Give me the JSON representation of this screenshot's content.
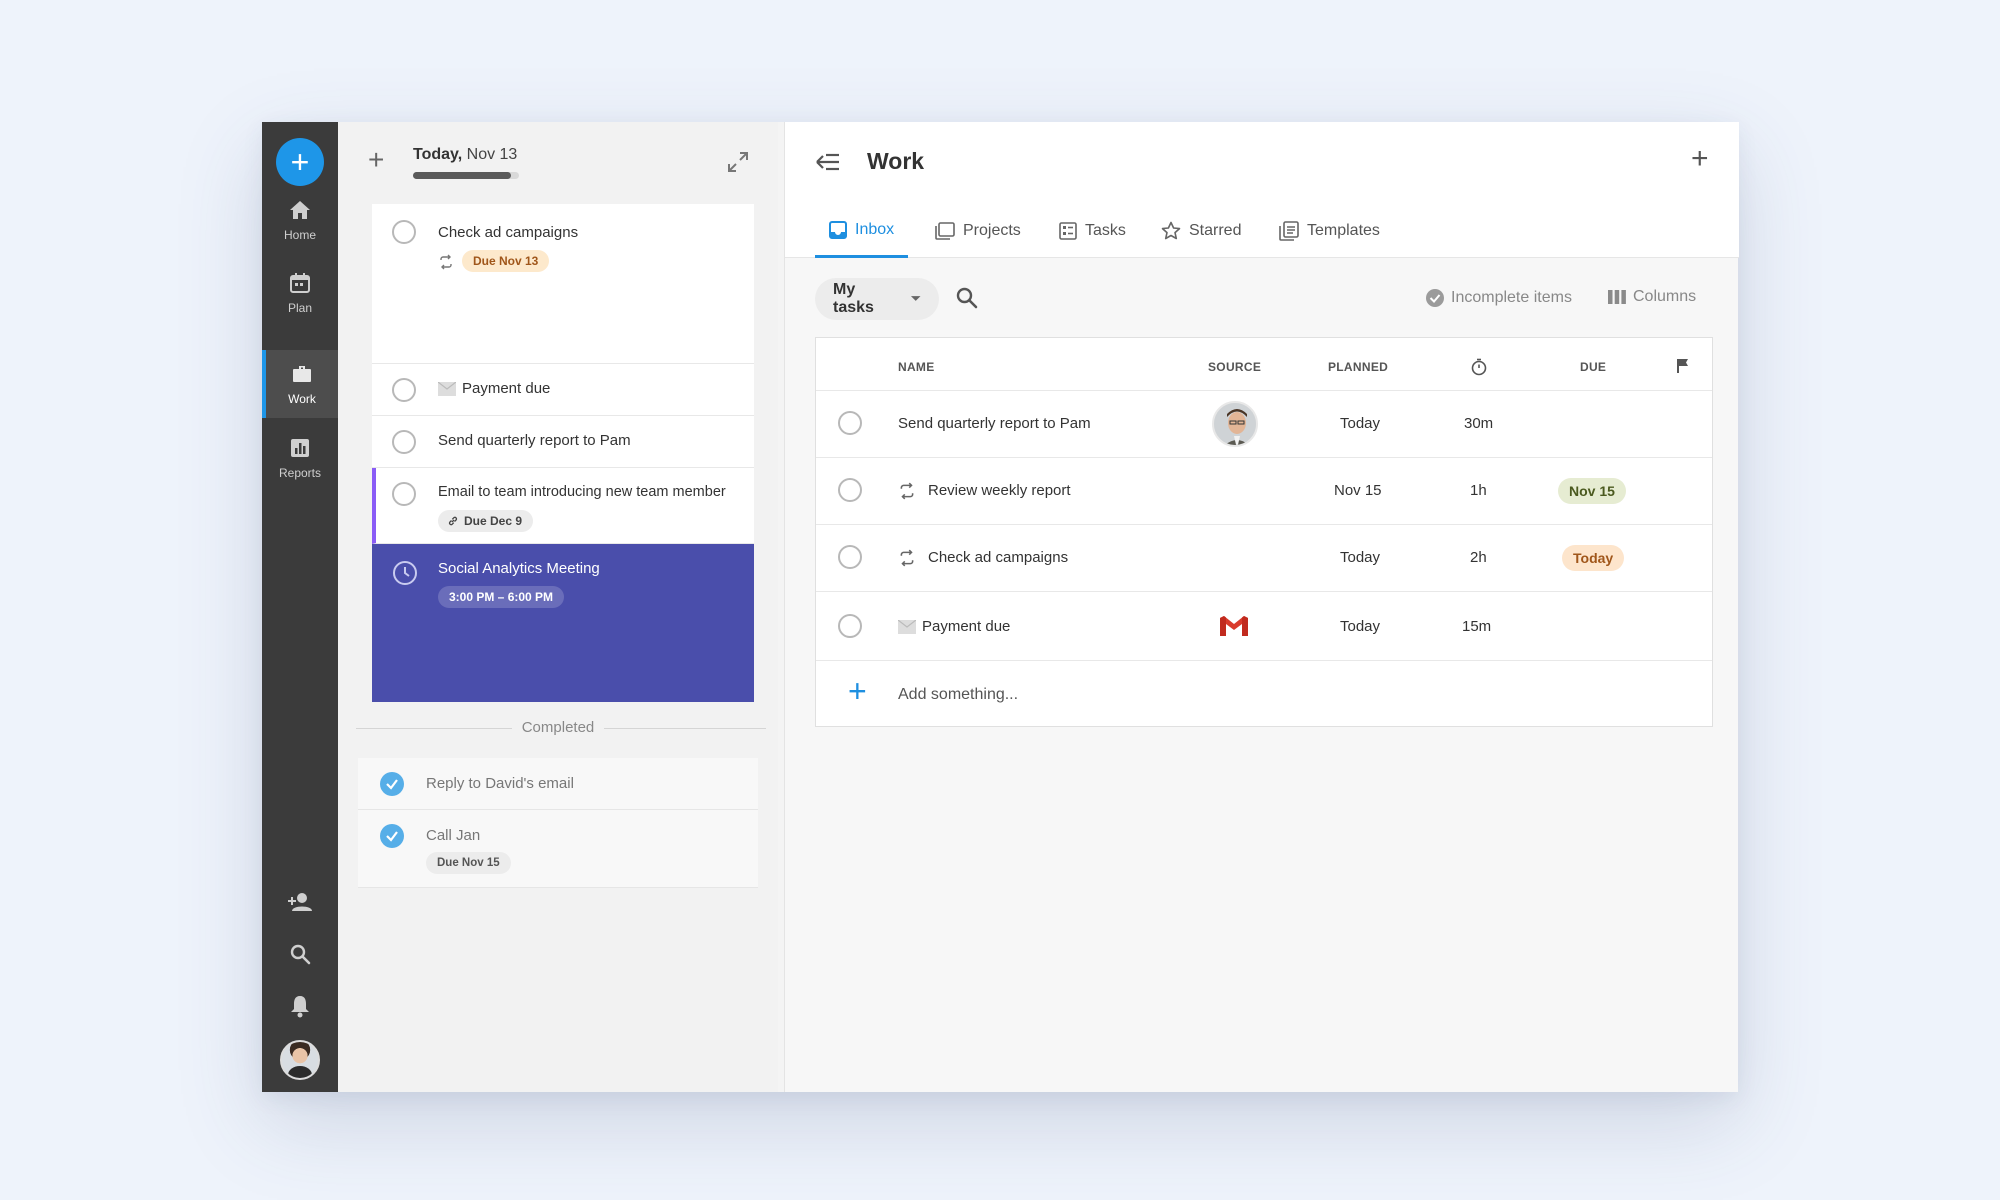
{
  "rail": {
    "items": [
      {
        "label": "Home"
      },
      {
        "label": "Plan"
      },
      {
        "label": "Work"
      },
      {
        "label": "Reports"
      }
    ]
  },
  "planner": {
    "date_bold": "Today,",
    "date_rest": " Nov 13",
    "progress": 0.92,
    "tasks": [
      {
        "title": "Check ad campaigns",
        "chip": "Due Nov 13"
      },
      {
        "title": "Payment due"
      },
      {
        "title": "Send quarterly report to Pam"
      },
      {
        "title": "Email to team introducing new team member",
        "chip": "Due Dec 9"
      }
    ],
    "meeting": {
      "title": "Social Analytics Meeting",
      "time": "3:00 PM – 6:00 PM"
    },
    "completed_label": "Completed",
    "completed": [
      {
        "title": "Reply to David's email"
      },
      {
        "title": "Call Jan",
        "chip": "Due Nov 15"
      }
    ]
  },
  "work": {
    "title": "Work",
    "tabs": [
      {
        "label": "Inbox",
        "icon": "inbox-icon"
      },
      {
        "label": "Projects",
        "icon": "projects-icon"
      },
      {
        "label": "Tasks",
        "icon": "tasks-icon"
      },
      {
        "label": "Starred",
        "icon": "star-icon"
      },
      {
        "label": "Templates",
        "icon": "templates-icon"
      }
    ],
    "filter": "My tasks",
    "incomplete_label": "Incomplete items",
    "columns_label": "Columns",
    "headers": {
      "name": "NAME",
      "source": "SOURCE",
      "planned": "PLANNED",
      "due": "DUE"
    },
    "rows": [
      {
        "name": "Send quarterly report to Pam",
        "source": "person-avatar",
        "planned": "Today",
        "duration": "30m",
        "due": ""
      },
      {
        "name": "Review weekly report",
        "source": "",
        "planned": "Nov 15",
        "duration": "1h",
        "due": "Nov 15"
      },
      {
        "name": "Check ad campaigns",
        "source": "",
        "planned": "Today",
        "duration": "2h",
        "due": "Today"
      },
      {
        "name": "Payment due",
        "source": "gmail-icon",
        "planned": "Today",
        "duration": "15m",
        "due": ""
      }
    ],
    "add_placeholder": "Add something..."
  },
  "colors": {
    "accent": "#1e8fe0",
    "meeting": "#4a4eab",
    "rail": "#3b3b3b"
  }
}
